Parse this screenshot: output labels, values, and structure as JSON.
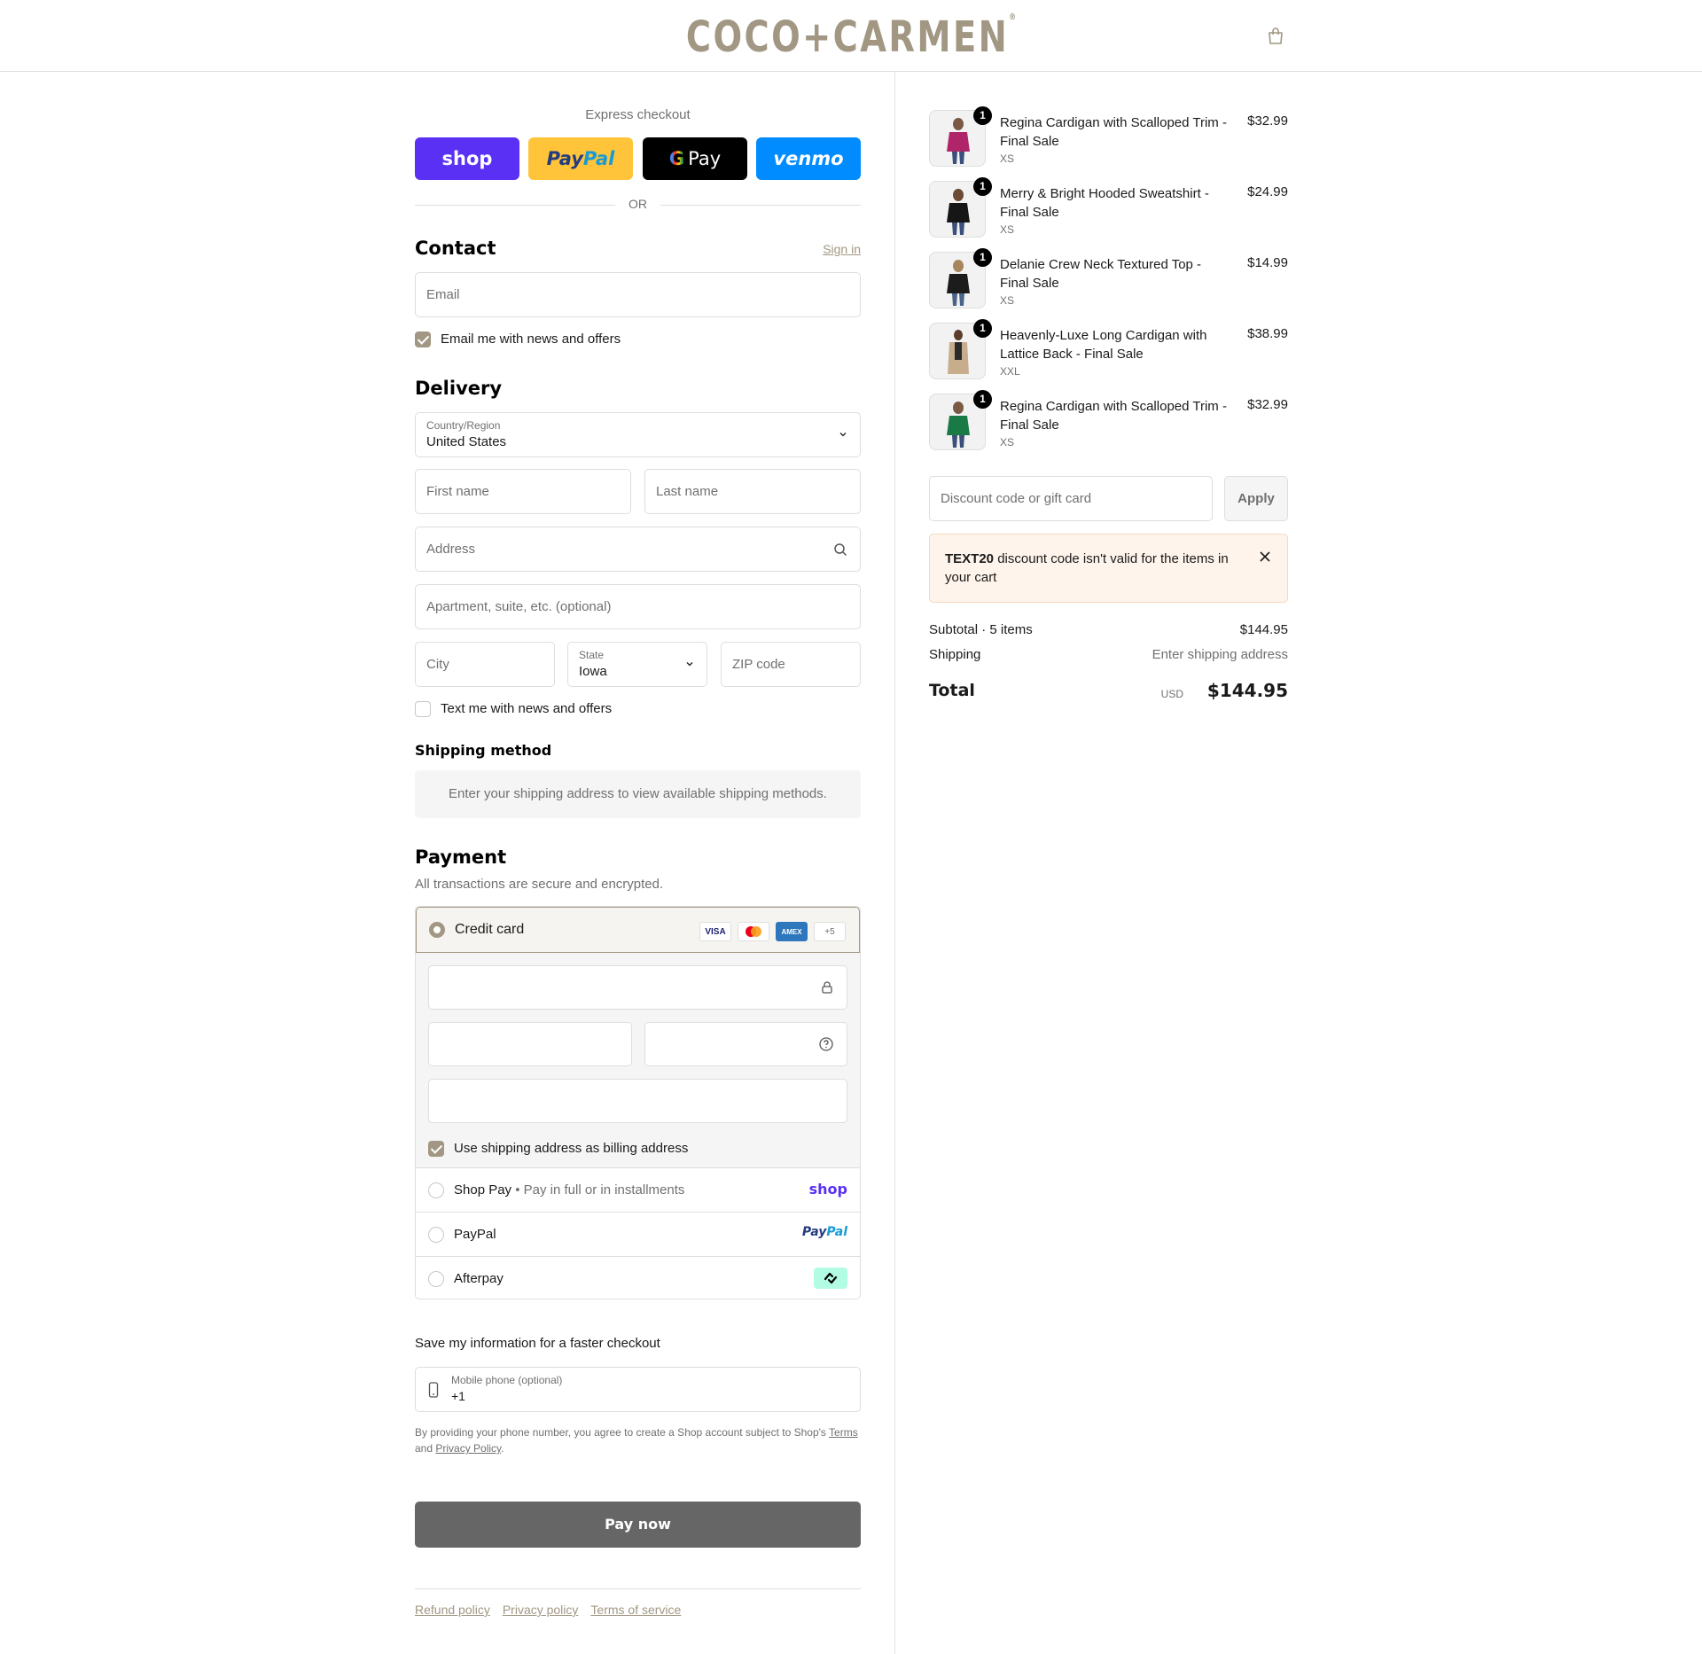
{
  "brand": {
    "name": "COCO+CARMEN",
    "accent": "#a19783"
  },
  "express": {
    "title": "Express checkout",
    "buttons": [
      "shop",
      "PayPal",
      "Pay",
      "venmo"
    ],
    "or_label": "OR"
  },
  "contact": {
    "heading": "Contact",
    "sign_in": "Sign in",
    "email_placeholder": "Email",
    "newsletter_label": "Email me with news and offers",
    "newsletter_checked": true
  },
  "delivery": {
    "heading": "Delivery",
    "country_label": "Country/Region",
    "country_value": "United States",
    "first_name_placeholder": "First name",
    "last_name_placeholder": "Last name",
    "address_placeholder": "Address",
    "apartment_placeholder": "Apartment, suite, etc. (optional)",
    "city_placeholder": "City",
    "state_label": "State",
    "state_value": "Iowa",
    "zip_placeholder": "ZIP code",
    "sms_label": "Text me with news and offers",
    "sms_checked": false
  },
  "shipping_method": {
    "heading": "Shipping method",
    "message": "Enter your shipping address to view available shipping methods."
  },
  "payment": {
    "heading": "Payment",
    "subtitle": "All transactions are secure and encrypted.",
    "credit_card_label": "Credit card",
    "card_logos": [
      "VISA",
      "MC",
      "AMEX",
      "+5"
    ],
    "billing_same_label": "Use shipping address as billing address",
    "billing_same_checked": true,
    "shop_pay_label": "Shop Pay",
    "shop_pay_sub": "Pay in full or in installments",
    "shop_pay_logo": "shop",
    "paypal_label": "PayPal",
    "paypal_logo": "PayPal",
    "afterpay_label": "Afterpay"
  },
  "save_info": {
    "title": "Save my information for a faster checkout",
    "phone_label": "Mobile phone (optional)",
    "phone_value": "+1",
    "legal_prefix": "By providing your phone number, you agree to create a Shop account subject to Shop's",
    "terms": "Terms",
    "and": "and",
    "privacy": "Privacy Policy",
    "period": "."
  },
  "pay_now": "Pay now",
  "footer": {
    "links": [
      "Refund policy",
      "Privacy policy",
      "Terms of service"
    ]
  },
  "cart": {
    "items": [
      {
        "qty": "1",
        "name": "Regina Cardigan with Scalloped Trim - Final Sale",
        "variant": "XS",
        "price": "$32.99",
        "color": "#b0246a"
      },
      {
        "qty": "1",
        "name": "Merry & Bright Hooded Sweatshirt - Final Sale",
        "variant": "XS",
        "price": "$24.99",
        "color": "#161616"
      },
      {
        "qty": "1",
        "name": "Delanie Crew Neck Textured Top - Final Sale",
        "variant": "XS",
        "price": "$14.99",
        "color": "#1c1c1c"
      },
      {
        "qty": "1",
        "name": "Heavenly-Luxe Long Cardigan with Lattice Back - Final Sale",
        "variant": "XXL",
        "price": "$38.99",
        "color": "#c8ad8c"
      },
      {
        "qty": "1",
        "name": "Regina Cardigan with Scalloped Trim - Final Sale",
        "variant": "XS",
        "price": "$32.99",
        "color": "#1a7a45"
      }
    ],
    "discount_placeholder": "Discount code or gift card",
    "apply": "Apply",
    "alert_code": "TEXT20",
    "alert_message": "discount code isn't valid for the items in your cart",
    "subtotal_label": "Subtotal · 5 items",
    "subtotal_value": "$144.95",
    "shipping_label": "Shipping",
    "shipping_value": "Enter shipping address",
    "total_label": "Total",
    "total_currency": "USD",
    "total_value": "$144.95"
  }
}
